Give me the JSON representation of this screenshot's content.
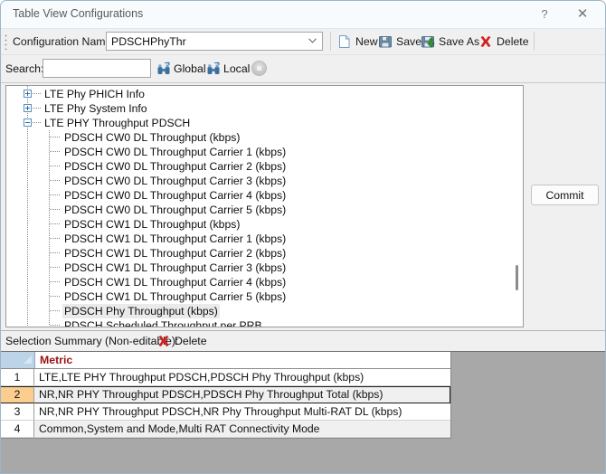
{
  "window": {
    "title": "Table View Configurations",
    "help_label": "?",
    "close_label": "✕"
  },
  "toolbar": {
    "config_label": "Configuration Name:",
    "config_value": "PDSCHPhyThr",
    "new_label": "New",
    "save_label": "Save",
    "save_as_label": "Save As",
    "delete_label": "Delete"
  },
  "search": {
    "label": "Search:",
    "value": "",
    "placeholder": "",
    "global_label": "Global",
    "local_label": "Local"
  },
  "tree": {
    "nodes": [
      {
        "label": "LTE Phy PHICH Info",
        "level": 0,
        "toggle": "plus"
      },
      {
        "label": "LTE Phy System Info",
        "level": 0,
        "toggle": "plus"
      },
      {
        "label": "LTE PHY Throughput PDSCH",
        "level": 0,
        "toggle": "minus"
      },
      {
        "label": "PDSCH CW0 DL Throughput (kbps)",
        "level": 1,
        "toggle": "none"
      },
      {
        "label": "PDSCH CW0 DL Throughput Carrier 1 (kbps)",
        "level": 1,
        "toggle": "none"
      },
      {
        "label": "PDSCH CW0 DL Throughput Carrier 2 (kbps)",
        "level": 1,
        "toggle": "none"
      },
      {
        "label": "PDSCH CW0 DL Throughput Carrier 3 (kbps)",
        "level": 1,
        "toggle": "none"
      },
      {
        "label": "PDSCH CW0 DL Throughput Carrier 4 (kbps)",
        "level": 1,
        "toggle": "none"
      },
      {
        "label": "PDSCH CW0 DL Throughput Carrier 5 (kbps)",
        "level": 1,
        "toggle": "none"
      },
      {
        "label": "PDSCH CW1 DL Throughput (kbps)",
        "level": 1,
        "toggle": "none"
      },
      {
        "label": "PDSCH CW1 DL Throughput Carrier 1 (kbps)",
        "level": 1,
        "toggle": "none"
      },
      {
        "label": "PDSCH CW1 DL Throughput Carrier 2 (kbps)",
        "level": 1,
        "toggle": "none"
      },
      {
        "label": "PDSCH CW1 DL Throughput Carrier 3 (kbps)",
        "level": 1,
        "toggle": "none"
      },
      {
        "label": "PDSCH CW1 DL Throughput Carrier 4 (kbps)",
        "level": 1,
        "toggle": "none"
      },
      {
        "label": "PDSCH CW1 DL Throughput Carrier 5 (kbps)",
        "level": 1,
        "toggle": "none"
      },
      {
        "label": "PDSCH Phy Throughput (kbps)",
        "level": 1,
        "toggle": "none",
        "selected": true
      },
      {
        "label": "PDSCH Scheduled Throughput per PRB",
        "level": 1,
        "toggle": "none"
      }
    ]
  },
  "commit": {
    "label": "Commit"
  },
  "summary": {
    "label": "Selection Summary (Non-editable):",
    "delete_label": "Delete"
  },
  "grid": {
    "header": "Metric",
    "rows": [
      {
        "num": "1",
        "metric": "LTE,LTE PHY Throughput PDSCH,PDSCH Phy Throughput (kbps)"
      },
      {
        "num": "2",
        "metric": "NR,NR PHY Throughput PDSCH,PDSCH Phy Throughput Total (kbps)",
        "selected": true
      },
      {
        "num": "3",
        "metric": "NR,NR PHY Throughput PDSCH,NR Phy Throughput Multi-RAT DL (kbps)"
      },
      {
        "num": "4",
        "metric": "Common,System and Mode,Multi RAT Connectivity Mode",
        "alt": true
      }
    ]
  },
  "colors": {
    "header_accent": "#9b1111",
    "selected_row": "#fbcd8f",
    "corner": "#bcd3e8",
    "delete_icon": "#d42020"
  }
}
